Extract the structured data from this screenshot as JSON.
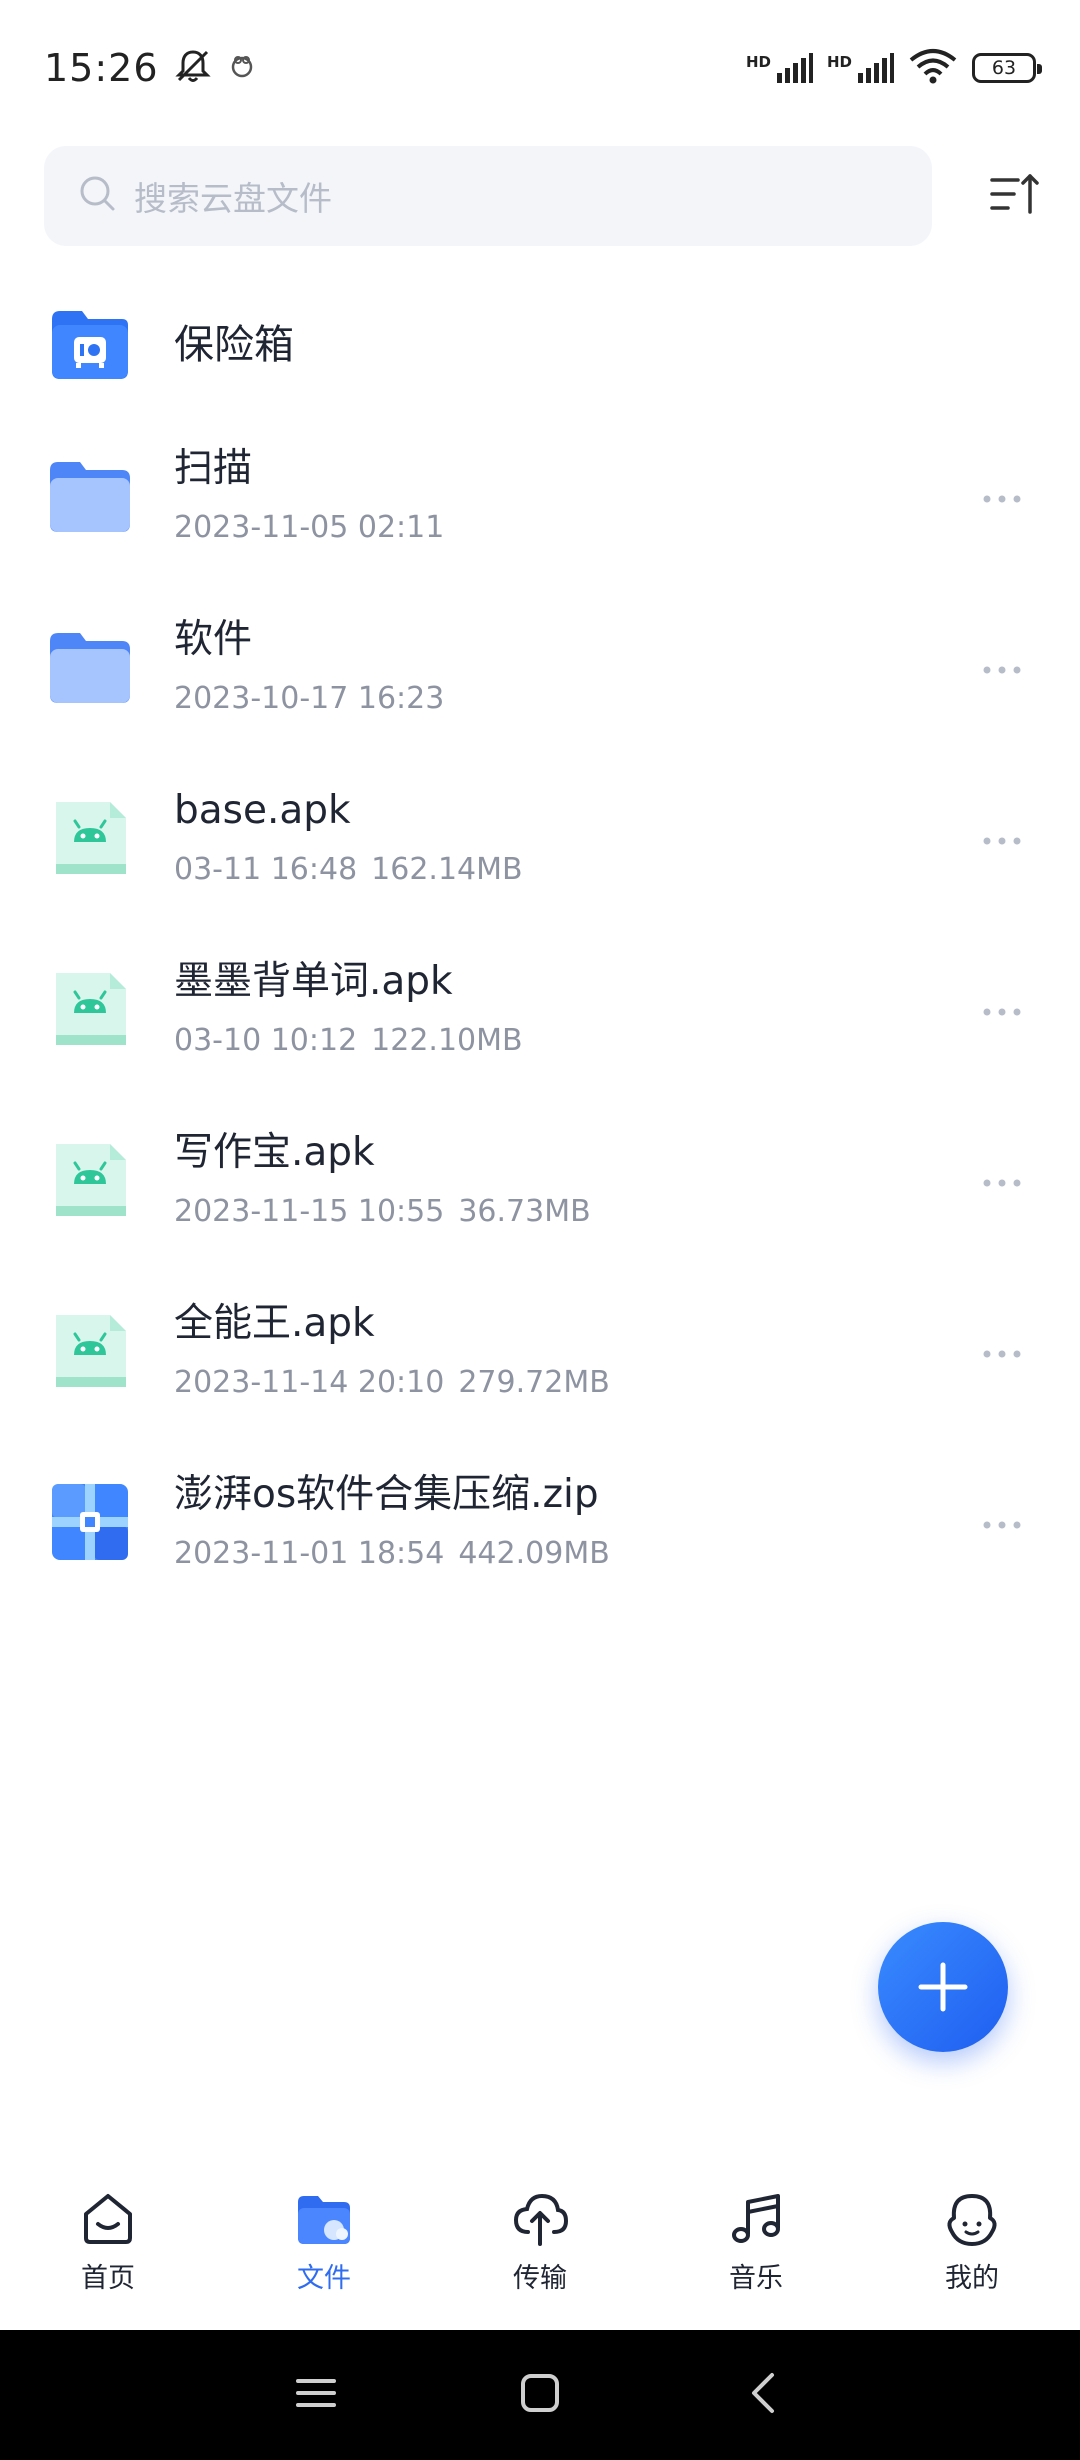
{
  "status": {
    "time": "15:26",
    "hd1": "HD",
    "hd2": "HD",
    "battery": "63"
  },
  "search": {
    "placeholder": "搜索云盘文件"
  },
  "vault": {
    "name": "保险箱"
  },
  "files": [
    {
      "name": "扫描",
      "date": "2023-11-05 02:11",
      "size": "",
      "type": "folder"
    },
    {
      "name": "软件",
      "date": "2023-10-17 16:23",
      "size": "",
      "type": "folder"
    },
    {
      "name": "base.apk",
      "date": "03-11 16:48",
      "size": "162.14MB",
      "type": "apk"
    },
    {
      "name": "墨墨背单词.apk",
      "date": "03-10 10:12",
      "size": "122.10MB",
      "type": "apk"
    },
    {
      "name": "写作宝.apk",
      "date": "2023-11-15 10:55",
      "size": "36.73MB",
      "type": "apk"
    },
    {
      "name": "全能王.apk",
      "date": "2023-11-14 20:10",
      "size": "279.72MB",
      "type": "apk"
    },
    {
      "name": "澎湃os软件合集压缩.zip",
      "date": "2023-11-01 18:54",
      "size": "442.09MB",
      "type": "zip"
    }
  ],
  "nav": {
    "home": "首页",
    "files": "文件",
    "transfer": "传输",
    "music": "音乐",
    "mine": "我的"
  },
  "colors": {
    "accent": "#2f6cf0",
    "folder": "#8fb6ff",
    "apk": "#2fc79a"
  }
}
